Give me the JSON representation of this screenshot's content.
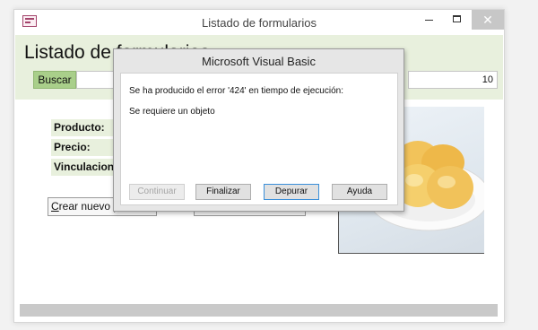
{
  "window": {
    "title": "Listado  de formularios",
    "close_glyph": "✕"
  },
  "form": {
    "title": "Listado  de formularios",
    "buscar_label": "Buscar",
    "search_value": "",
    "record_count": "10",
    "fields": [
      {
        "label": "Producto:"
      },
      {
        "label": "Precio:"
      },
      {
        "label": "Vinculacion:"
      }
    ],
    "create_button_accesskey": "C",
    "create_button_rest": "rear nuevo p"
  },
  "dialog": {
    "title": "Microsoft Visual Basic",
    "message_line1": "Se ha producido el error '424' en tiempo de ejecución:",
    "message_line2": "Se requiere un objeto",
    "buttons": {
      "continuar": "Continuar",
      "finalizar": "Finalizar",
      "depurar": "Depurar",
      "ayuda": "Ayuda"
    }
  },
  "colors": {
    "header_green": "#e8f0dd",
    "button_green": "#a9cf8a",
    "focus_blue": "#3a8fd9"
  }
}
